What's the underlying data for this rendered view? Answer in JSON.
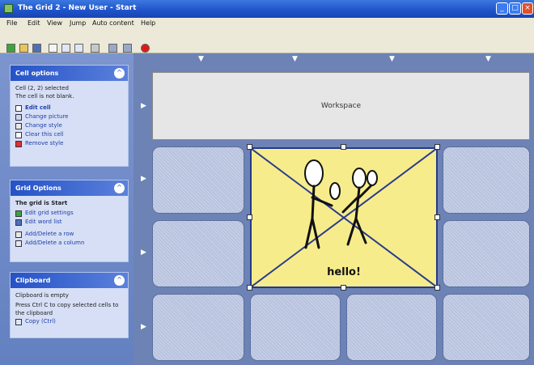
{
  "window": {
    "title": "The Grid 2 - New User - Start"
  },
  "menu": [
    "File",
    "Edit",
    "View",
    "Jump",
    "Auto content",
    "Help"
  ],
  "cell_options": {
    "title": "Cell options",
    "status": "Cell (2, 2) selected",
    "hint": "The cell is not blank.",
    "links": [
      "Edit cell",
      "Change picture",
      "Change style",
      "Clear this cell",
      "Remove style"
    ],
    "icons": [
      "pencil-icon",
      "picture-icon",
      "style-icon",
      "page-icon",
      "remove-icon"
    ]
  },
  "grid_options": {
    "title": "Grid Options",
    "current": "The grid is Start",
    "links": [
      "Edit grid settings",
      "Edit word list",
      "Add/Delete a row",
      "Add/Delete a column"
    ],
    "icons": [
      "grid-settings-icon",
      "word-list-icon",
      "row-icon",
      "column-icon"
    ]
  },
  "clipboard": {
    "title": "Clipboard",
    "status": "Clipboard is empty",
    "hint": "Press Ctrl C to copy selected cells to the clipboard",
    "links": [
      "Copy (Ctrl)"
    ],
    "icons": [
      "copy-icon"
    ]
  },
  "grid": {
    "workspace_label": "Workspace",
    "selected_cell_text": "hello!"
  },
  "colors": {
    "title_bar": "#1f52c9",
    "panel_header": "#2552c7",
    "selected_cell": "#f7ec8c",
    "grid_background": "#6d83b5"
  }
}
